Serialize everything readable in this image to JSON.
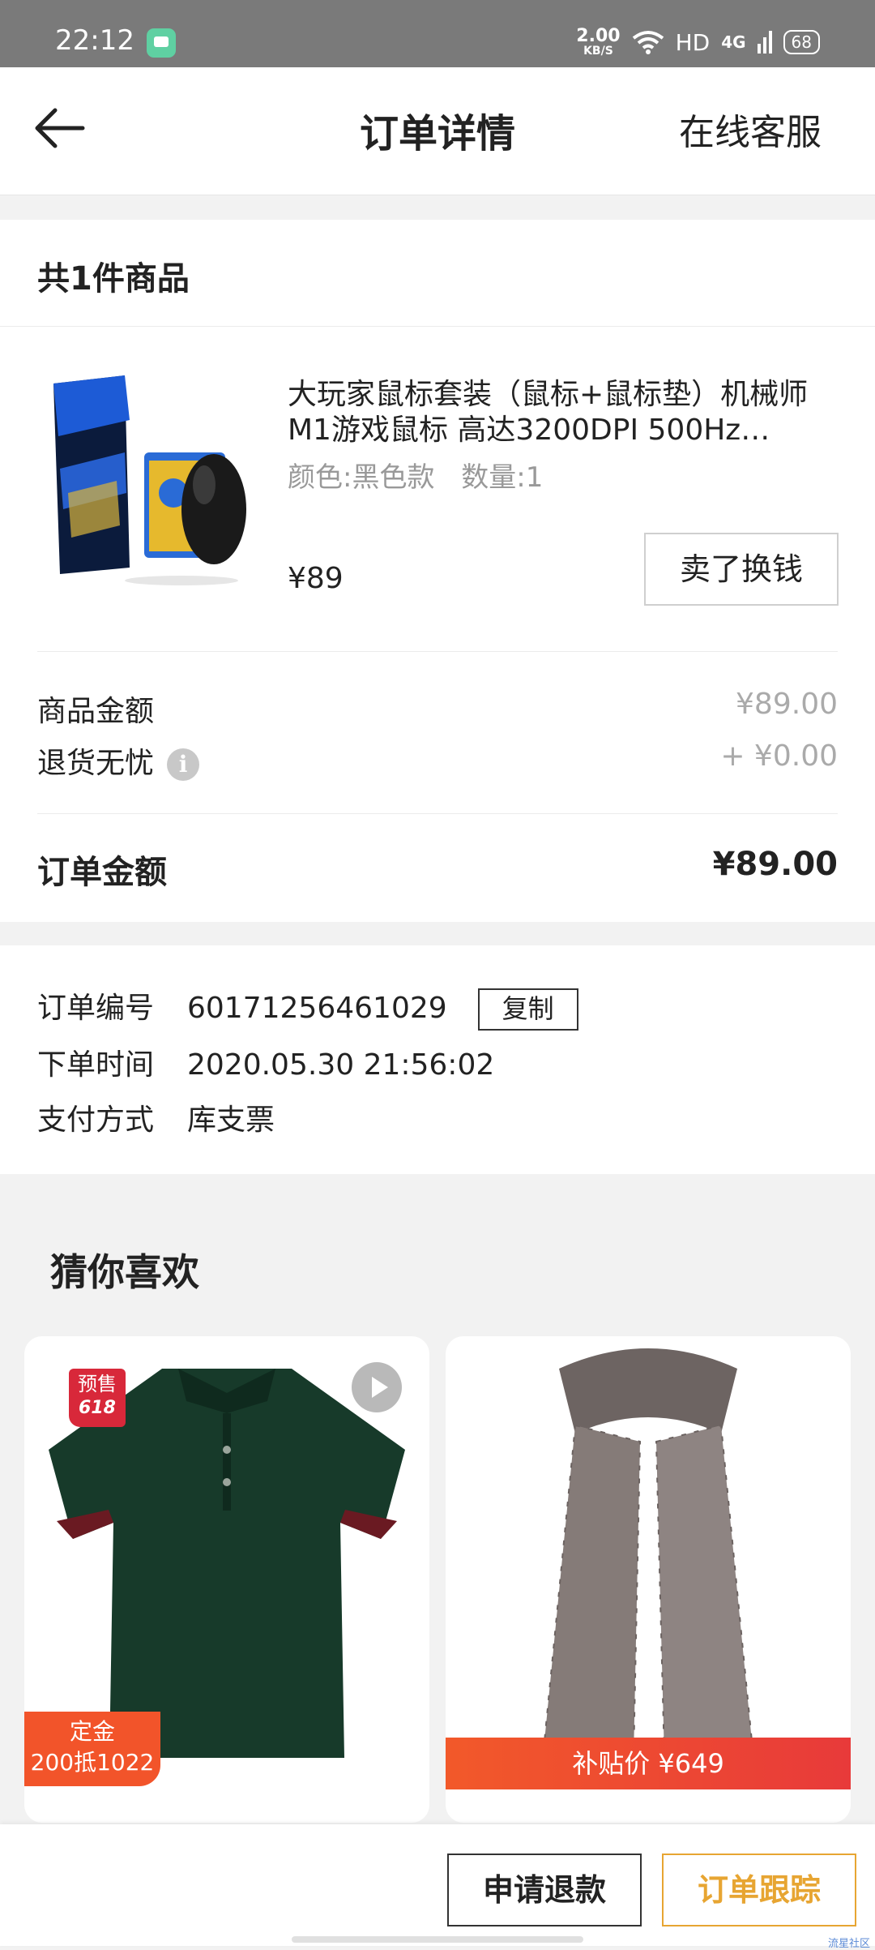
{
  "status_bar": {
    "time": "22:12",
    "net_speed_value": "2.00",
    "net_speed_unit": "KB/S",
    "hd": "HD",
    "signal": "4G",
    "battery": "68"
  },
  "header": {
    "title": "订单详情",
    "service": "在线客服"
  },
  "order_items": {
    "count_label": "共1件商品",
    "product": {
      "title": "大玩家鼠标套装（鼠标+鼠标垫）机械师M1游戏鼠标 高达3200DPI 500Hz…",
      "color": "颜色:黑色款",
      "quantity": "数量:1",
      "price": "¥89",
      "sell_button": "卖了换钱"
    },
    "goods_amount_label": "商品金额",
    "goods_amount_value": "¥89.00",
    "return_label": "退货无忧",
    "return_value": "+ ¥0.00",
    "order_total_label": "订单金额",
    "order_total_value": "¥89.00"
  },
  "order_info": {
    "number_label": "订单编号",
    "number_value": "60171256461029",
    "copy_button": "复制",
    "time_label": "下单时间",
    "time_value": "2020.05.30 21:56:02",
    "payment_label": "支付方式",
    "payment_value": "库支票"
  },
  "recommend": {
    "title": "猜你喜欢",
    "items": [
      {
        "badge_top": "预售",
        "badge_bottom": "618",
        "deposit_line1": "定金",
        "deposit_line2": "200抵1022"
      },
      {
        "subsidy": "补贴价 ¥649"
      }
    ]
  },
  "bottom": {
    "refund_button": "申请退款",
    "track_button": "订单跟踪",
    "watermark": "流星社区"
  },
  "colors": {
    "accent": "#e7a532",
    "promo_red": "#f2542a",
    "badge_red": "#d8283a"
  }
}
